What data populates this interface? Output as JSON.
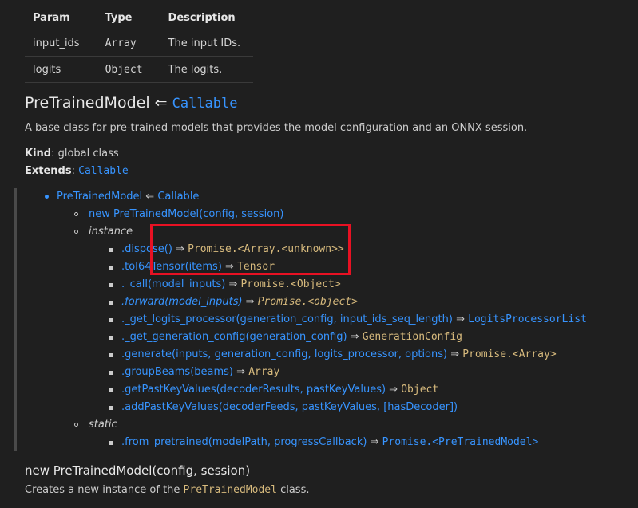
{
  "params_table": {
    "headers": [
      "Param",
      "Type",
      "Description"
    ],
    "rows": [
      {
        "param": "input_ids",
        "type": "Array",
        "description": "The input IDs."
      },
      {
        "param": "logits",
        "type": "Object",
        "description": "The logits."
      }
    ]
  },
  "section": {
    "title": "PreTrainedModel",
    "arrow": "⇐",
    "parent": "Callable",
    "description": "A base class for pre-trained models that provides the model configuration and an ONNX session.",
    "kind_label": "Kind",
    "kind_value": ": global class",
    "extends_label": "Extends",
    "extends_sep": ": ",
    "extends_value": "Callable"
  },
  "toc": {
    "root": {
      "name": "PreTrainedModel",
      "arrow": " ⇐ ",
      "parent": "Callable"
    },
    "constructor": "new PreTrainedModel(config, session)",
    "instance_label": "instance",
    "static_label": "static",
    "instance_items": [
      {
        "link": ".dispose()",
        "arrow": " ⇒ ",
        "ret": "Promise.<Array.<unknown>>"
      },
      {
        "link": ".toI64Tensor(items)",
        "arrow": " ⇒ ",
        "ret": "Tensor"
      },
      {
        "link": "._call(model_inputs)",
        "arrow": " ⇒ ",
        "ret": "Promise.<Object>"
      },
      {
        "link": ".forward(model_inputs)",
        "arrow": " ⇒ ",
        "ret": "Promise.<object>"
      },
      {
        "link": "._get_logits_processor(generation_config, input_ids_seq_length)",
        "arrow": " ⇒ ",
        "ret": "LogitsProcessorList"
      },
      {
        "link": "._get_generation_config(generation_config)",
        "arrow": " ⇒ ",
        "ret": "GenerationConfig"
      },
      {
        "link": ".generate(inputs, generation_config, logits_processor, options)",
        "arrow": " ⇒ ",
        "ret": "Promise.<Array>"
      },
      {
        "link": ".groupBeams(beams)",
        "arrow": " ⇒ ",
        "ret": "Array"
      },
      {
        "link": ".getPastKeyValues(decoderResults, pastKeyValues)",
        "arrow": " ⇒ ",
        "ret": "Object"
      },
      {
        "link": ".addPastKeyValues(decoderFeeds, pastKeyValues, [hasDecoder])",
        "arrow": "",
        "ret": ""
      }
    ],
    "static_items": [
      {
        "link": ".from_pretrained(modelPath, progressCallback)",
        "arrow": " ⇒ ",
        "ret": "Promise.<PreTrainedModel>"
      }
    ]
  },
  "constructor_section": {
    "title": "new PreTrainedModel(config, session)",
    "desc_before": "Creates a new instance of the ",
    "desc_code": "PreTrainedModel",
    "desc_after": " class."
  }
}
